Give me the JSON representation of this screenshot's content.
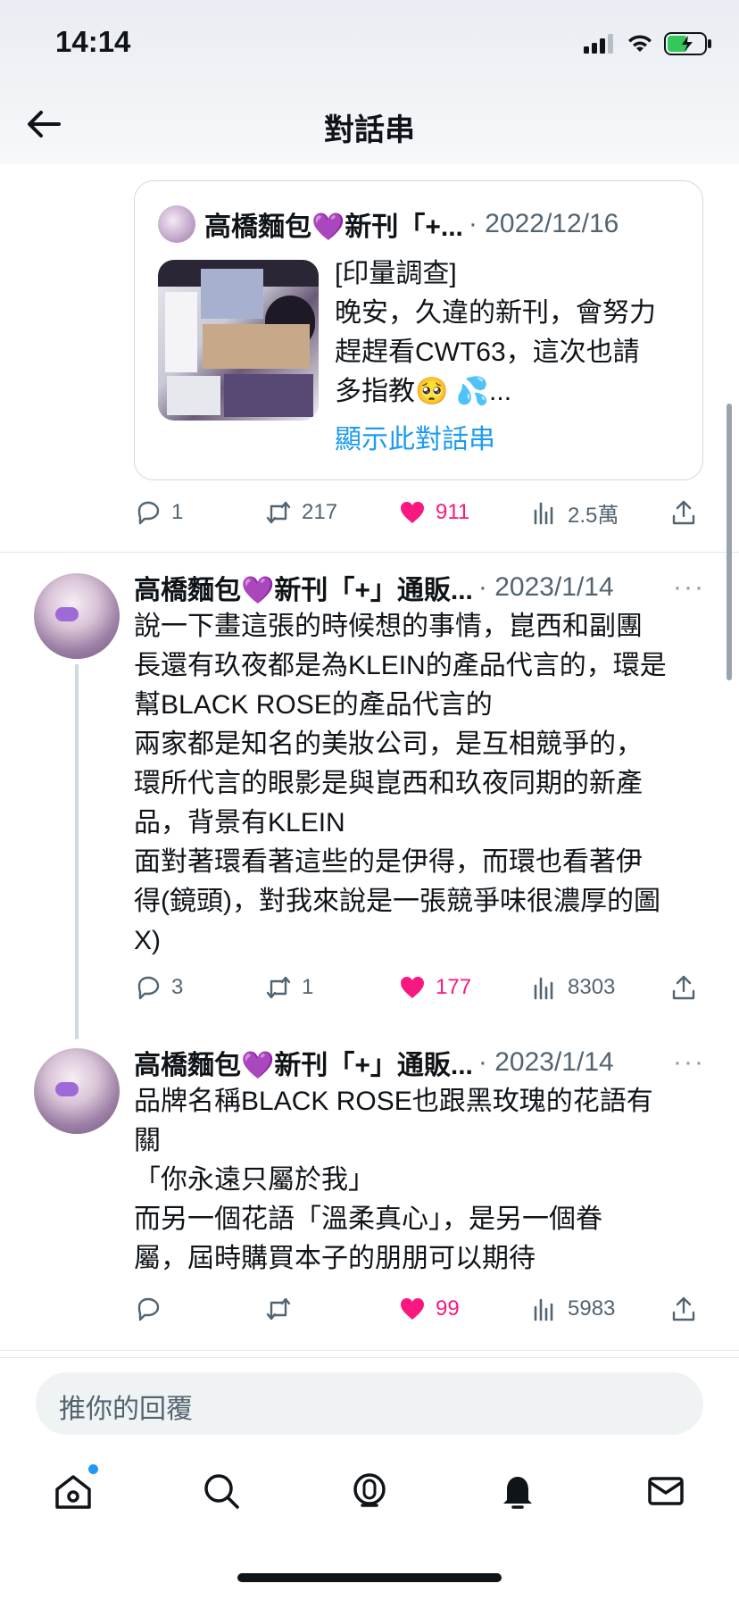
{
  "status_bar": {
    "time": "14:14"
  },
  "header": {
    "title": "對話串"
  },
  "quoted_tweet": {
    "author": "高橋麵包💜新刊「+...",
    "date": "· 2022/12/16",
    "lines": [
      "[印量調查]",
      "晚安，久違的新刊，會努力",
      "趕趕看CWT63，這次也請",
      "多指教🥺 💦..."
    ],
    "show_thread": "顯示此對話串"
  },
  "quoted_actions": {
    "replies": "1",
    "retweets": "217",
    "likes": "911",
    "views": "2.5萬"
  },
  "tweets": [
    {
      "author": "高橋麵包💜新刊「+」通販...",
      "date": "· 2023/1/14",
      "more": "···",
      "body": "說一下畫這張的時候想的事情，崑西和副團\n長還有玖夜都是為KLEIN的產品代言的，環是\n幫BLACK ROSE的產品代言的\n兩家都是知名的美妝公司，是互相競爭的，\n環所代言的眼影是與崑西和玖夜同期的新產\n品，背景有KLEIN\n面對著環看著這些的是伊得，而環也看著伊\n得(鏡頭)，對我來說是一張競爭味很濃厚的圖\nX)",
      "actions": {
        "replies": "3",
        "retweets": "1",
        "likes": "177",
        "views": "8303"
      }
    },
    {
      "author": "高橋麵包💜新刊「+」通販...",
      "date": "· 2023/1/14",
      "more": "···",
      "body": "品牌名稱BLACK ROSE也跟黑玫瑰的花語有\n關\n「你永遠只屬於我」\n而另一個花語「溫柔真心」，是另一個眷\n屬，屆時購買本子的朋朋可以期待",
      "actions": {
        "replies": "",
        "retweets": "",
        "likes": "99",
        "views": "5983"
      }
    }
  ],
  "reply_box": {
    "placeholder": "推你的回覆"
  },
  "colors": {
    "accent": "#1d9bf0",
    "like": "#f91880",
    "muted": "#536471"
  },
  "icons": [
    "back-arrow-icon",
    "reply-icon",
    "retweet-icon",
    "heart-icon",
    "views-icon",
    "share-icon",
    "home-icon",
    "search-icon",
    "spaces-icon",
    "bell-icon",
    "mail-icon"
  ]
}
